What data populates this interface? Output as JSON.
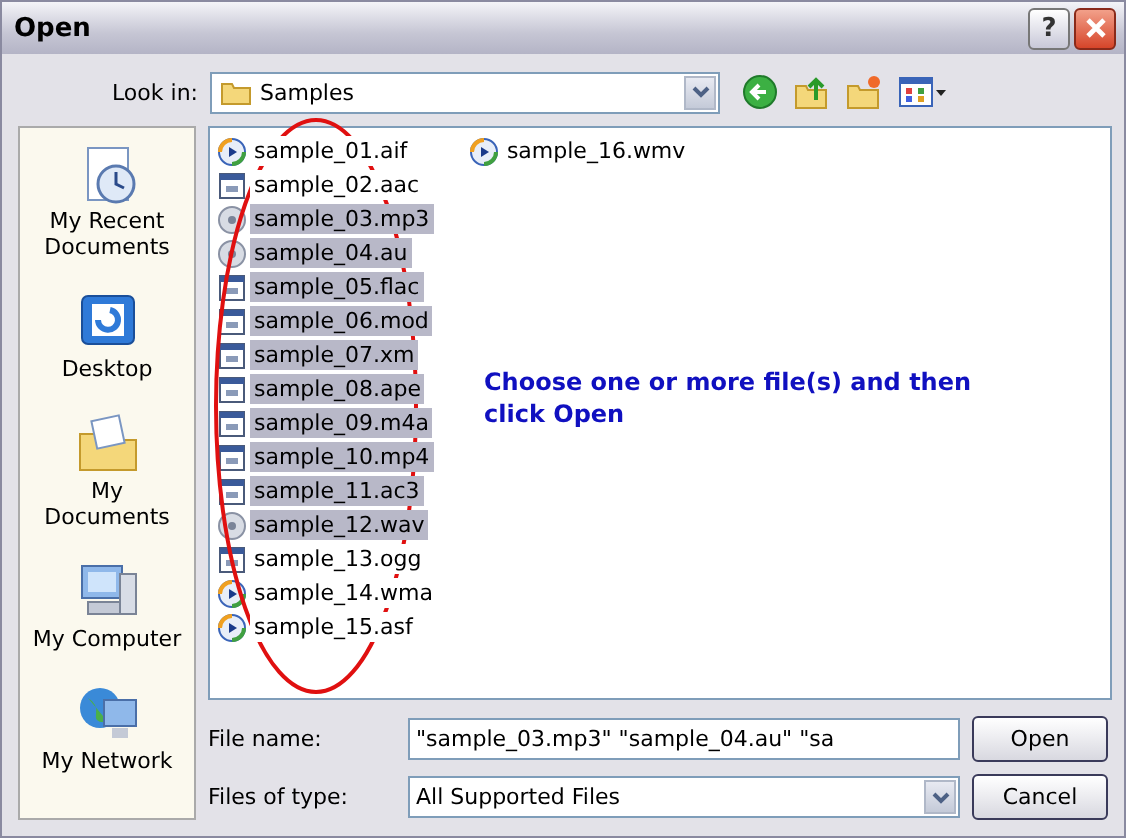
{
  "window": {
    "title": "Open",
    "help_button": "?"
  },
  "look_in": {
    "label": "Look in:",
    "value": "Samples"
  },
  "places": [
    {
      "label": "My Recent Documents",
      "kind": "recent"
    },
    {
      "label": "Desktop",
      "kind": "desktop"
    },
    {
      "label": "My Documents",
      "kind": "documents"
    },
    {
      "label": "My Computer",
      "kind": "computer"
    },
    {
      "label": "My Network",
      "kind": "network"
    }
  ],
  "files": [
    {
      "name": "sample_01.aif",
      "kind": "player",
      "selected": false
    },
    {
      "name": "sample_02.aac",
      "kind": "window",
      "selected": false
    },
    {
      "name": "sample_03.mp3",
      "kind": "disc",
      "selected": true
    },
    {
      "name": "sample_04.au",
      "kind": "disc",
      "selected": true
    },
    {
      "name": "sample_05.flac",
      "kind": "window",
      "selected": true
    },
    {
      "name": "sample_06.mod",
      "kind": "window",
      "selected": true
    },
    {
      "name": "sample_07.xm",
      "kind": "window",
      "selected": true
    },
    {
      "name": "sample_08.ape",
      "kind": "window",
      "selected": true
    },
    {
      "name": "sample_09.m4a",
      "kind": "window",
      "selected": true
    },
    {
      "name": "sample_10.mp4",
      "kind": "window",
      "selected": true
    },
    {
      "name": "sample_11.ac3",
      "kind": "window",
      "selected": true
    },
    {
      "name": "sample_12.wav",
      "kind": "disc",
      "selected": true
    },
    {
      "name": "sample_13.ogg",
      "kind": "window",
      "selected": false
    },
    {
      "name": "sample_14.wma",
      "kind": "player",
      "selected": false
    },
    {
      "name": "sample_15.asf",
      "kind": "player",
      "selected": false
    },
    {
      "name": "sample_16.wmv",
      "kind": "player",
      "selected": false
    }
  ],
  "annotation": {
    "text": "Choose one or more file(s) and then click Open"
  },
  "file_name": {
    "label": "File name:",
    "value": "\"sample_03.mp3\" \"sample_04.au\" \"sa"
  },
  "files_of_type": {
    "label": "Files of type:",
    "value": "All Supported Files"
  },
  "buttons": [
    "Open",
    "Cancel"
  ]
}
